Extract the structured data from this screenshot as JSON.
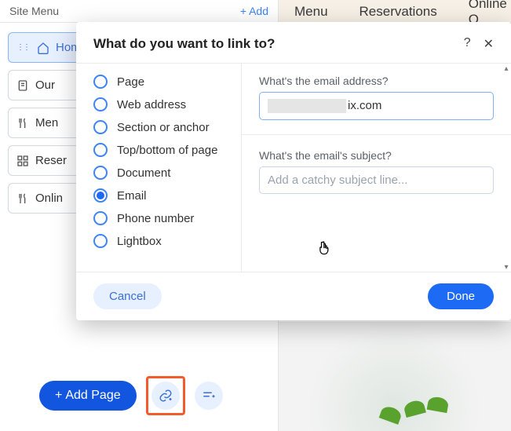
{
  "siteMenu": {
    "title": "Site Menu",
    "addLabel": "Add",
    "items": [
      {
        "label": "Hom",
        "icon": "home-icon",
        "selected": true
      },
      {
        "label": "Our",
        "icon": "page-icon"
      },
      {
        "label": "Men",
        "icon": "menu-icon"
      },
      {
        "label": "Reser",
        "icon": "grid-icon"
      },
      {
        "label": "Onlin",
        "icon": "menu-icon"
      }
    ],
    "addPageLabel": "Add Page"
  },
  "canvasNav": {
    "items": [
      "Menu",
      "Reservations",
      "Online O"
    ]
  },
  "modal": {
    "title": "What do you want to link to?",
    "helpGlyph": "?",
    "closeGlyph": "✕",
    "linkTypes": [
      "Page",
      "Web address",
      "Section or anchor",
      "Top/bottom of page",
      "Document",
      "Email",
      "Phone number",
      "Lightbox"
    ],
    "selectedType": "Email",
    "emailField": {
      "label": "What's the email address?",
      "valueSuffix": "ix.com"
    },
    "subjectField": {
      "label": "What's the email's subject?",
      "placeholder": "Add a catchy subject line..."
    },
    "cancelLabel": "Cancel",
    "doneLabel": "Done"
  }
}
